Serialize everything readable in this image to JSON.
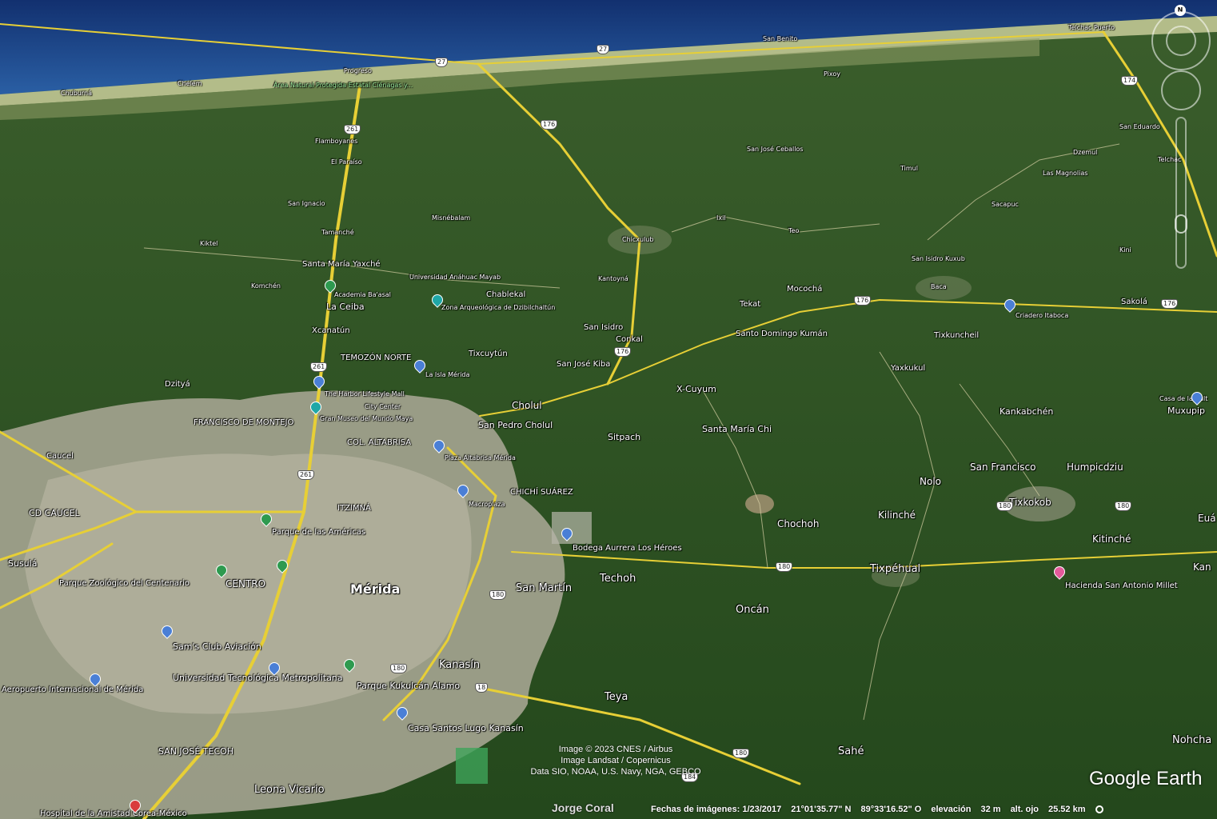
{
  "map": {
    "labels": {
      "telchac_puerto": "Telchac Puerto",
      "san_benito": "San Benito",
      "progreso": "Progreso",
      "chelem": "Chelem",
      "chuburna": "Chuburná",
      "pixoy": "Pixoy",
      "area_natural": "Área Natural Protegida Estatal Ciénagas y...",
      "flamboyanes": "Flamboyanes",
      "el_paraiso": "El Paraíso",
      "san_ignacio": "San Ignacio",
      "misnebalam": "Misnébalam",
      "tamanche": "Tamanché",
      "kiktel": "Kiktel",
      "santa_maria_yaxche": "Santa María Yaxché",
      "komchen": "Komchén",
      "academia": "Academia Ba'asal",
      "univ_anahuac": "Universidad Anáhuac Mayab",
      "chablekal": "Chablekal",
      "zona_arq": "Zona Arqueológica de Dzibilchaltún",
      "la_ceiba": "La Ceiba",
      "xcanatun": "Xcanatún",
      "temozon": "TEMOZÓN NORTE",
      "la_isla": "La Isla Mérida",
      "tixcuytun": "Tixcuytún",
      "harbor": "The Harbor Lifestyle Mall",
      "city_center": "City Center",
      "gran_museo": "Gran Museo del Mundo Maya",
      "dzitya": "Dzityá",
      "francisco": "FRANCISCO DE MONTEJO",
      "cholul": "Cholul",
      "san_pedro_cholul": "San Pedro Cholul",
      "col_altabrisa": "COL. ALTABRISA",
      "plaza_altabrisa": "Plaza Altabrisa Mérida",
      "caucel": "Caucel",
      "cd_caucel": "CD CAUCEL",
      "itzimna": "ITZIMNÁ",
      "chichi_suarez": "CHICHÍ SUÁREZ",
      "macroplaza": "Macroplaza",
      "parque_americas": "Parque de las Américas",
      "bodega": "Bodega Aurrera Los Héroes",
      "susula": "Susulá",
      "parque_zoologico": "Parque Zoológico del Centenario",
      "centro": "CENTRO",
      "merida": "Mérida",
      "san_martin": "San Martín",
      "techoh": "Techoh",
      "sams": "Sam's Club Aviación",
      "utm": "Universidad Tecnológica Metropolitana",
      "aeropuerto": "Aeropuerto Internacional de Mérida",
      "parque_kukulcan": "Parque Kukulcán Alamo",
      "kanasin": "Kanasín",
      "teya": "Teya",
      "casa_santos": "Casa Santos Lugo Kanasín",
      "san_jose_tecoh": "SAN JOSÉ TECOH",
      "leona_vicario": "Leona Vicario",
      "hospital": "Hospital de la Amistad Corea-México",
      "san_jose_ceballos": "San José Ceballos",
      "chicxulub": "Chicxulub",
      "ixil": "Ixil",
      "teo": "Teo",
      "kantoyna": "Kantoyná",
      "mococha": "Mocochá",
      "tekat": "Tekat",
      "santo_domingo": "Santo Domingo Kumán",
      "san_isidro": "San Isidro",
      "conkal": "Conkal",
      "san_jose_kiba": "San José Kiba",
      "x_cuyum": "X-Cuyum",
      "santa_maria_chi": "Santa María Chi",
      "sitpach": "Sitpach",
      "chochoh": "Chochoh",
      "oncan": "Oncán",
      "timul": "Timul",
      "san_eduardo": "San Eduardo",
      "dzemul": "Dzemul",
      "las_magnolias": "Las Magnolias",
      "telchac": "Telchac",
      "sacapuc": "Sacapuc",
      "kini": "Kini",
      "san_isidro_kuxub": "San Isidro Kuxub",
      "baca": "Baca",
      "criadero": "Criadero Itaboca",
      "sakola": "Sakolá",
      "tixkuncheil": "Tixkuncheil",
      "yaxkukul": "Yaxkukul",
      "kankabchen": "Kankabchén",
      "casa_cultura": "Casa de la Cult",
      "muxupip": "Muxupip",
      "san_francisco": "San Francisco",
      "humpicdziu": "Humpicdziu",
      "nolo": "Nolo",
      "tixkokob": "Tixkokob",
      "kilinche": "Kilinché",
      "eua": "Euá",
      "kitinche": "Kitinché",
      "tixpehual": "Tixpéhual",
      "hacienda": "Hacienda San Antonio Millet",
      "kan": "Kan",
      "nohcha": "Nohcha",
      "sahe": "Sahé"
    },
    "shields": {
      "r27a": "27",
      "r27b": "27",
      "r261a": "261",
      "r261b": "261",
      "r261c": "261",
      "r176a": "176",
      "r176b": "176",
      "r176c": "176",
      "r176d": "176",
      "r174": "174",
      "r180a": "180",
      "r180b": "180",
      "r180c": "180",
      "r180d": "180",
      "r180e": "180",
      "r180f": "180",
      "r18": "18",
      "r184": "184"
    }
  },
  "navigation": {
    "north_label": "N"
  },
  "attribution": {
    "line1": "Image © 2023 CNES / Airbus",
    "line2": "Image Landsat / Copernicus",
    "line3": "Data SIO, NOAA, U.S. Navy, NGA, GEBCO",
    "owner": "Jorge Coral",
    "logo": "Google Earth"
  },
  "status": {
    "imagery_date": "Fechas de imágenes: 1/23/2017",
    "latitude": "21°01'35.77\" N",
    "longitude": "89°33'16.52\" O",
    "elevation_label": "elevación",
    "elevation_value": "32 m",
    "eye_alt_label": "alt. ojo",
    "eye_alt_value": "25.52 km"
  },
  "colors": {
    "sea": "#1d3f86",
    "coast": "#cfd3a8",
    "forest": "#2a5224",
    "urban": "#a9a894",
    "road": "#e8cf3a"
  }
}
